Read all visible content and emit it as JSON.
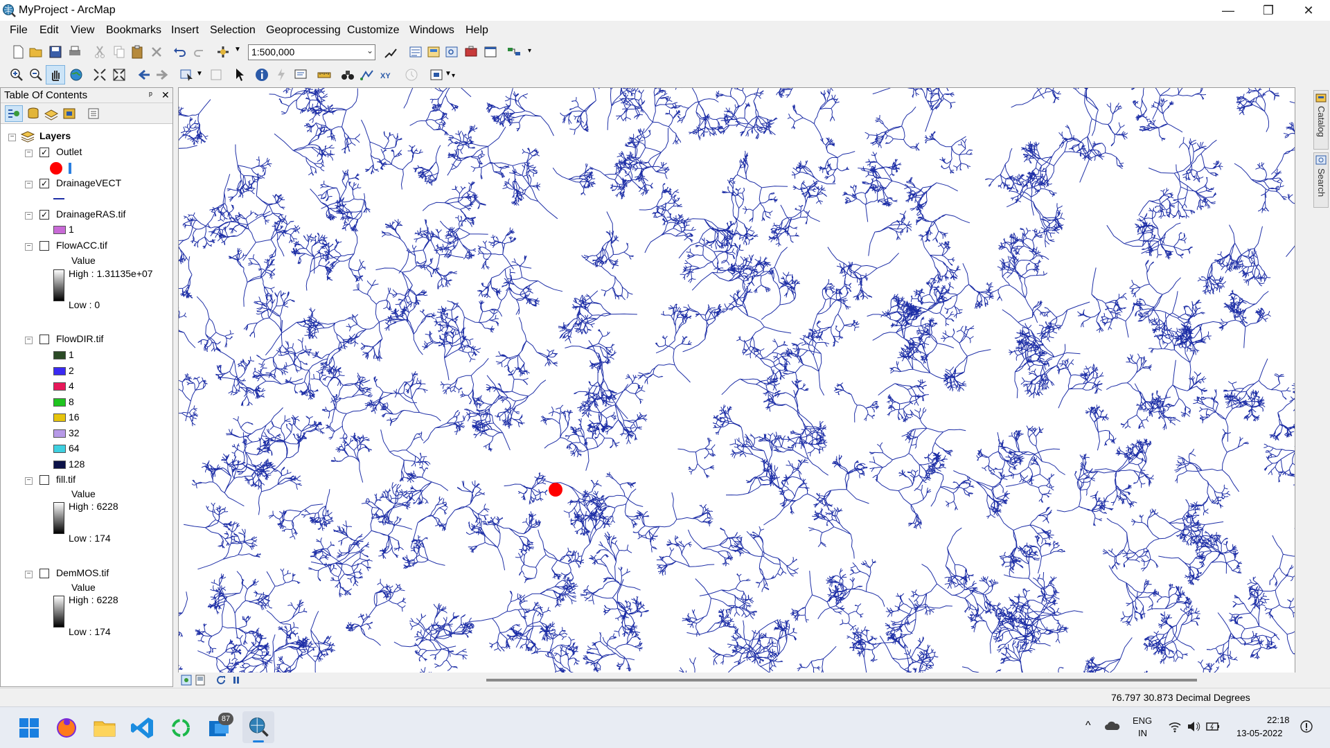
{
  "window": {
    "title": "MyProject - ArcMap",
    "min": "—",
    "max": "❐",
    "close": "✕"
  },
  "menu": [
    "File",
    "Edit",
    "View",
    "Bookmarks",
    "Insert",
    "Selection",
    "Geoprocessing",
    "Customize",
    "Windows",
    "Help"
  ],
  "toolbar": {
    "scale": "1:500,000"
  },
  "toc": {
    "title": "Table Of Contents",
    "pin": "ᵖ",
    "close": "✕",
    "root": "Layers",
    "layers": [
      {
        "name": "Outlet",
        "checked": true
      },
      {
        "name": "DrainageVECT",
        "checked": true
      },
      {
        "name": "DrainageRAS.tif",
        "checked": true,
        "class_label": "1",
        "class_color": "#c86ad6"
      },
      {
        "name": "FlowACC.tif",
        "checked": false,
        "field": "Value",
        "high": "High : 1.31135e+07",
        "low": "Low : 0"
      },
      {
        "name": "FlowDIR.tif",
        "checked": false,
        "classes": [
          {
            "label": "1",
            "color": "#2b4a26"
          },
          {
            "label": "2",
            "color": "#3a2af2"
          },
          {
            "label": "4",
            "color": "#e8185a"
          },
          {
            "label": "8",
            "color": "#1fc41f"
          },
          {
            "label": "16",
            "color": "#e6c40c"
          },
          {
            "label": "32",
            "color": "#b79ae8"
          },
          {
            "label": "64",
            "color": "#3ed0e0"
          },
          {
            "label": "128",
            "color": "#0c1248"
          }
        ]
      },
      {
        "name": "fill.tif",
        "checked": false,
        "field": "Value",
        "high": "High : 6228",
        "low": "Low : 174"
      },
      {
        "name": "DemMOS.tif",
        "checked": false,
        "field": "Value",
        "high": "High : 6228",
        "low": "Low : 174"
      }
    ]
  },
  "map": {
    "drainage_color": "#1d2ea6",
    "outlet_color": "#ff0000"
  },
  "side_tabs": [
    "Catalog",
    "Search"
  ],
  "status": {
    "coords": "76.797  30.873 Decimal Degrees"
  },
  "taskbar": {
    "badge": "87",
    "lang1": "ENG",
    "lang2": "IN",
    "time": "22:18",
    "date": "13-05-2022"
  }
}
